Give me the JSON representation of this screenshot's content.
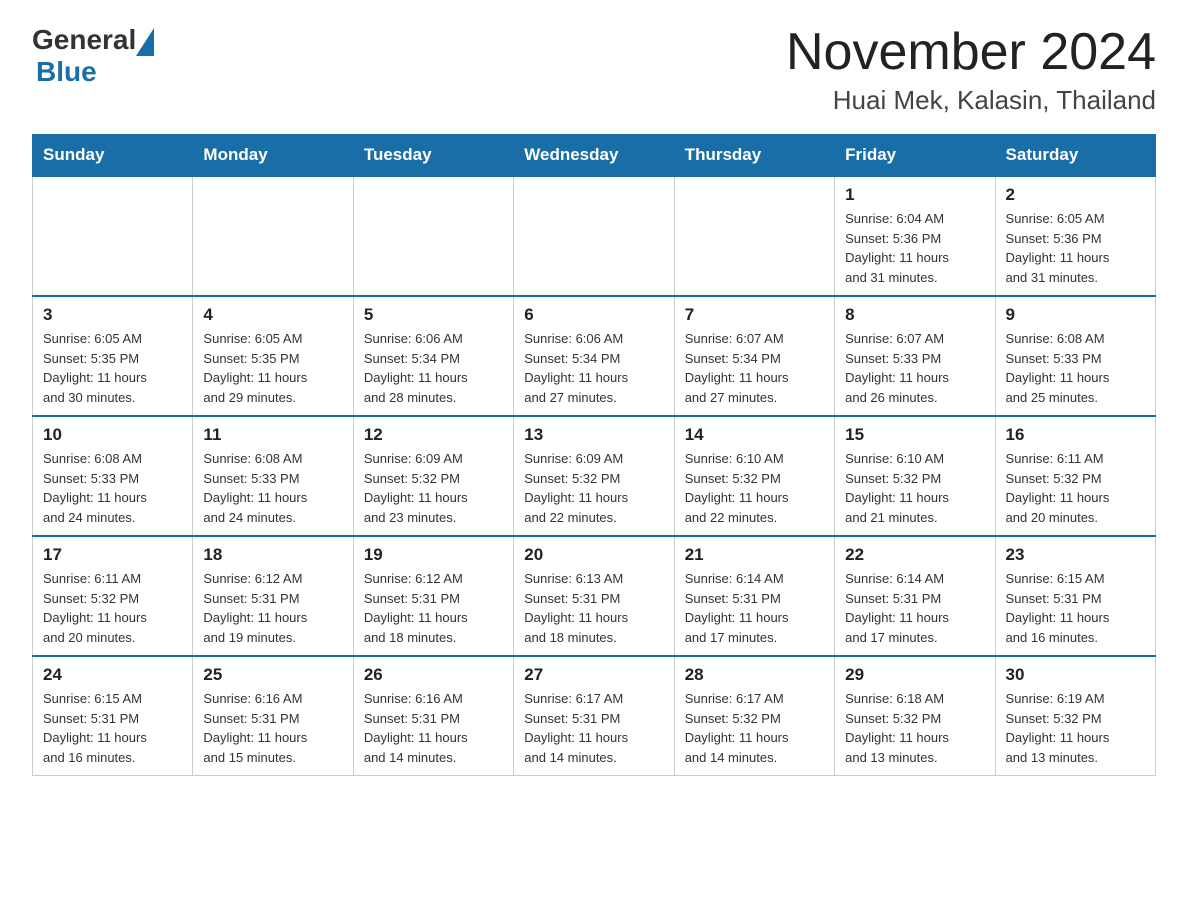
{
  "header": {
    "logo_general": "General",
    "logo_blue": "Blue",
    "month_title": "November 2024",
    "location": "Huai Mek, Kalasin, Thailand"
  },
  "weekdays": [
    "Sunday",
    "Monday",
    "Tuesday",
    "Wednesday",
    "Thursday",
    "Friday",
    "Saturday"
  ],
  "weeks": [
    [
      {
        "day": "",
        "info": ""
      },
      {
        "day": "",
        "info": ""
      },
      {
        "day": "",
        "info": ""
      },
      {
        "day": "",
        "info": ""
      },
      {
        "day": "",
        "info": ""
      },
      {
        "day": "1",
        "info": "Sunrise: 6:04 AM\nSunset: 5:36 PM\nDaylight: 11 hours\nand 31 minutes."
      },
      {
        "day": "2",
        "info": "Sunrise: 6:05 AM\nSunset: 5:36 PM\nDaylight: 11 hours\nand 31 minutes."
      }
    ],
    [
      {
        "day": "3",
        "info": "Sunrise: 6:05 AM\nSunset: 5:35 PM\nDaylight: 11 hours\nand 30 minutes."
      },
      {
        "day": "4",
        "info": "Sunrise: 6:05 AM\nSunset: 5:35 PM\nDaylight: 11 hours\nand 29 minutes."
      },
      {
        "day": "5",
        "info": "Sunrise: 6:06 AM\nSunset: 5:34 PM\nDaylight: 11 hours\nand 28 minutes."
      },
      {
        "day": "6",
        "info": "Sunrise: 6:06 AM\nSunset: 5:34 PM\nDaylight: 11 hours\nand 27 minutes."
      },
      {
        "day": "7",
        "info": "Sunrise: 6:07 AM\nSunset: 5:34 PM\nDaylight: 11 hours\nand 27 minutes."
      },
      {
        "day": "8",
        "info": "Sunrise: 6:07 AM\nSunset: 5:33 PM\nDaylight: 11 hours\nand 26 minutes."
      },
      {
        "day": "9",
        "info": "Sunrise: 6:08 AM\nSunset: 5:33 PM\nDaylight: 11 hours\nand 25 minutes."
      }
    ],
    [
      {
        "day": "10",
        "info": "Sunrise: 6:08 AM\nSunset: 5:33 PM\nDaylight: 11 hours\nand 24 minutes."
      },
      {
        "day": "11",
        "info": "Sunrise: 6:08 AM\nSunset: 5:33 PM\nDaylight: 11 hours\nand 24 minutes."
      },
      {
        "day": "12",
        "info": "Sunrise: 6:09 AM\nSunset: 5:32 PM\nDaylight: 11 hours\nand 23 minutes."
      },
      {
        "day": "13",
        "info": "Sunrise: 6:09 AM\nSunset: 5:32 PM\nDaylight: 11 hours\nand 22 minutes."
      },
      {
        "day": "14",
        "info": "Sunrise: 6:10 AM\nSunset: 5:32 PM\nDaylight: 11 hours\nand 22 minutes."
      },
      {
        "day": "15",
        "info": "Sunrise: 6:10 AM\nSunset: 5:32 PM\nDaylight: 11 hours\nand 21 minutes."
      },
      {
        "day": "16",
        "info": "Sunrise: 6:11 AM\nSunset: 5:32 PM\nDaylight: 11 hours\nand 20 minutes."
      }
    ],
    [
      {
        "day": "17",
        "info": "Sunrise: 6:11 AM\nSunset: 5:32 PM\nDaylight: 11 hours\nand 20 minutes."
      },
      {
        "day": "18",
        "info": "Sunrise: 6:12 AM\nSunset: 5:31 PM\nDaylight: 11 hours\nand 19 minutes."
      },
      {
        "day": "19",
        "info": "Sunrise: 6:12 AM\nSunset: 5:31 PM\nDaylight: 11 hours\nand 18 minutes."
      },
      {
        "day": "20",
        "info": "Sunrise: 6:13 AM\nSunset: 5:31 PM\nDaylight: 11 hours\nand 18 minutes."
      },
      {
        "day": "21",
        "info": "Sunrise: 6:14 AM\nSunset: 5:31 PM\nDaylight: 11 hours\nand 17 minutes."
      },
      {
        "day": "22",
        "info": "Sunrise: 6:14 AM\nSunset: 5:31 PM\nDaylight: 11 hours\nand 17 minutes."
      },
      {
        "day": "23",
        "info": "Sunrise: 6:15 AM\nSunset: 5:31 PM\nDaylight: 11 hours\nand 16 minutes."
      }
    ],
    [
      {
        "day": "24",
        "info": "Sunrise: 6:15 AM\nSunset: 5:31 PM\nDaylight: 11 hours\nand 16 minutes."
      },
      {
        "day": "25",
        "info": "Sunrise: 6:16 AM\nSunset: 5:31 PM\nDaylight: 11 hours\nand 15 minutes."
      },
      {
        "day": "26",
        "info": "Sunrise: 6:16 AM\nSunset: 5:31 PM\nDaylight: 11 hours\nand 14 minutes."
      },
      {
        "day": "27",
        "info": "Sunrise: 6:17 AM\nSunset: 5:31 PM\nDaylight: 11 hours\nand 14 minutes."
      },
      {
        "day": "28",
        "info": "Sunrise: 6:17 AM\nSunset: 5:32 PM\nDaylight: 11 hours\nand 14 minutes."
      },
      {
        "day": "29",
        "info": "Sunrise: 6:18 AM\nSunset: 5:32 PM\nDaylight: 11 hours\nand 13 minutes."
      },
      {
        "day": "30",
        "info": "Sunrise: 6:19 AM\nSunset: 5:32 PM\nDaylight: 11 hours\nand 13 minutes."
      }
    ]
  ]
}
